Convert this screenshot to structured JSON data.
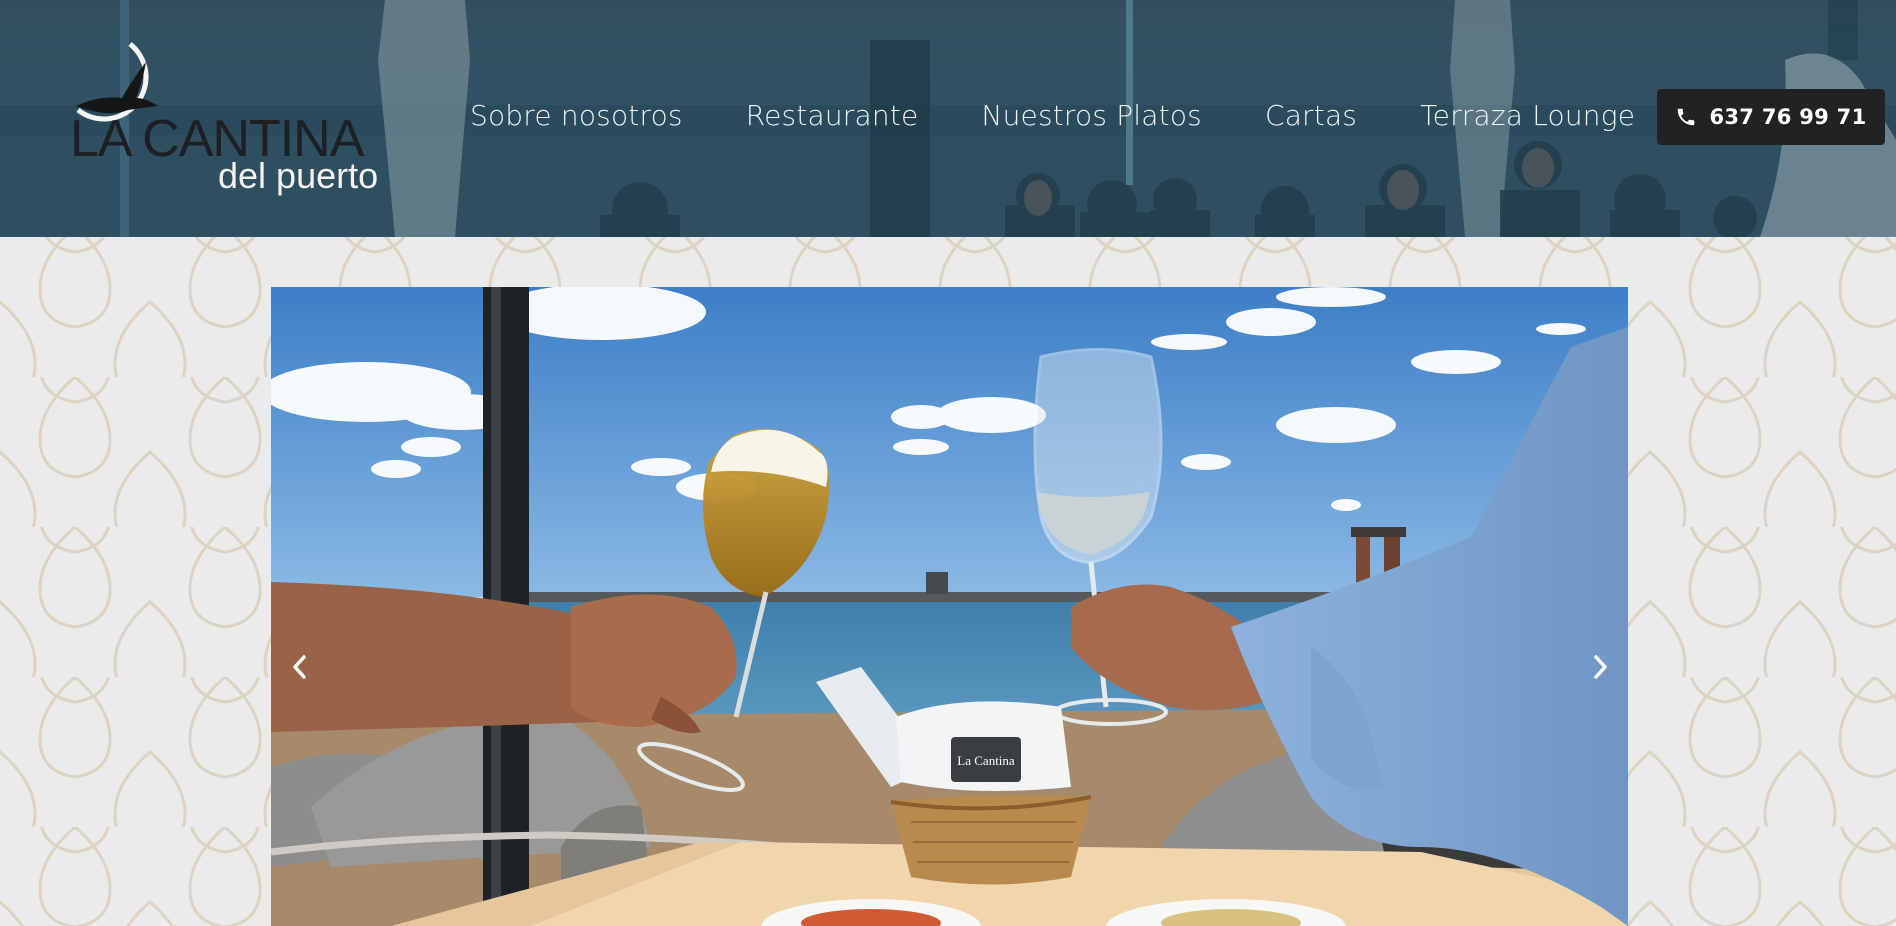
{
  "brand": {
    "logo_line1": "LA CANTINA",
    "logo_line2": "del puerto"
  },
  "nav": {
    "items": [
      {
        "label": "Sobre nosotros"
      },
      {
        "label": "Restaurante"
      },
      {
        "label": "Nuestros Platos"
      },
      {
        "label": "Cartas"
      },
      {
        "label": "Terraza Lounge"
      }
    ]
  },
  "contact": {
    "phone": "637 76 99 71",
    "icon": "phone-icon"
  },
  "slider": {
    "prev_icon": "chevron-left-icon",
    "next_icon": "chevron-right-icon",
    "basket_text": "La Cantina"
  },
  "colors": {
    "header": "#2f5364",
    "button": "#222222",
    "pattern_line": "#ddd3c3",
    "background": "#ebebeb"
  }
}
